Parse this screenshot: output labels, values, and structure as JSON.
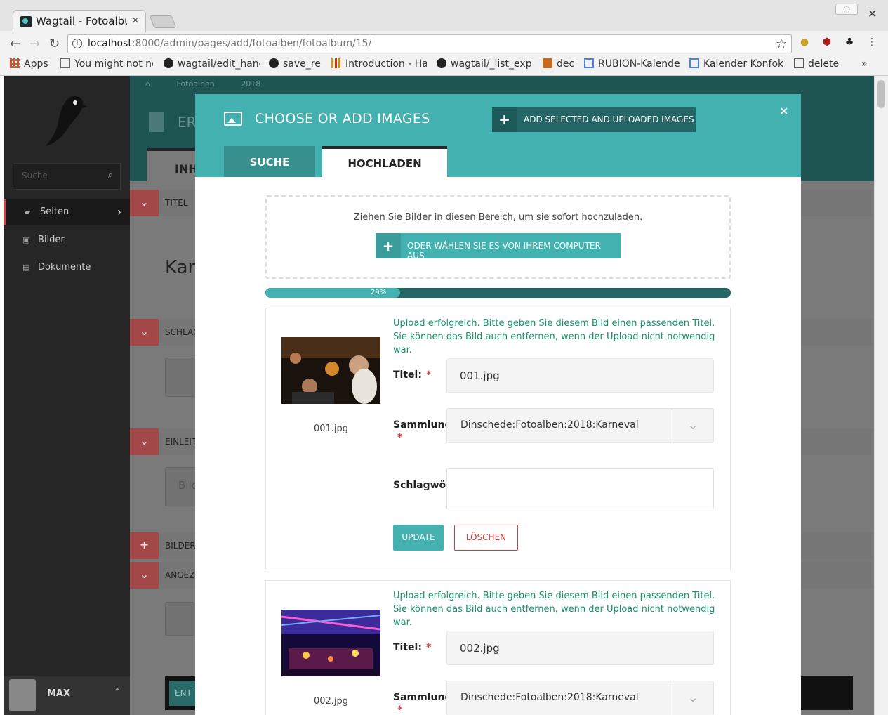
{
  "browser": {
    "tab_title": "Wagtail - Fotoalbum",
    "tab_close": "×",
    "url_host": "localhost",
    "url_path": ":8000/admin/pages/add/fotoalben/fotoalbum/15/",
    "bookmarks": [
      {
        "label": "Apps",
        "icon": "apps-grid-icon"
      },
      {
        "label": "You might not ne",
        "icon": "page-icon"
      },
      {
        "label": "wagtail/edit_hanc",
        "icon": "github-icon"
      },
      {
        "label": "save_re",
        "icon": "github-icon"
      },
      {
        "label": "Introduction - Ha",
        "icon": "chart-icon"
      },
      {
        "label": "wagtail/_list_exp",
        "icon": "github-icon"
      },
      {
        "label": "dec",
        "icon": "microscope-icon"
      },
      {
        "label": "RUBION-Kalende",
        "icon": "calendar-g-icon"
      },
      {
        "label": "Kalender Konfok",
        "icon": "calendar-g-icon"
      },
      {
        "label": "delete",
        "icon": "book-icon"
      }
    ],
    "bookmarks_more": "»"
  },
  "sidebar": {
    "search_placeholder": "Suche",
    "items": [
      {
        "label": "Seiten",
        "icon": "folder-open-icon"
      },
      {
        "label": "Bilder",
        "icon": "image-icon"
      },
      {
        "label": "Dokumente",
        "icon": "document-icon"
      }
    ],
    "user_name": "MAX"
  },
  "editor": {
    "breadcrumbs": [
      "Fotoalben",
      "2018"
    ],
    "title_partial": "ER",
    "tab_partial": "INH",
    "rows": [
      {
        "label": "TITEL",
        "button": "⌄"
      },
      {
        "label": "SCHLAG",
        "button": "⌄"
      },
      {
        "label": "EINLEIT",
        "button": "⌄"
      },
      {
        "label": "BILDER",
        "button": "+"
      },
      {
        "label": "ANGEZE",
        "button": "⌄"
      }
    ],
    "big_text": "Kar",
    "field_partial": "Bild",
    "bottom_button": "ENT"
  },
  "modal": {
    "title": "CHOOSE OR ADD IMAGES",
    "add_selected_label": "ADD SELECTED AND UPLOADED IMAGES",
    "close": "×",
    "tabs": [
      "SUCHE",
      "HOCHLADEN"
    ],
    "dropzone_text": "Ziehen Sie Bilder in diesen Bereich, um sie sofort hochzuladen.",
    "choose_button": "ODER WÄHLEN SIE ES VON IHREM COMPUTER AUS",
    "progress_percent": 29,
    "progress_label": "29%",
    "uploads": [
      {
        "message": "Upload erfolgreich. Bitte geben Sie diesem Bild einen passenden Titel. Sie können das Bild auch entfernen, wenn der Upload nicht notwendig war.",
        "filename": "001.jpg",
        "title_label": "Titel:",
        "title_value": "001.jpg",
        "collection_label": "Sammlung:",
        "collection_value": "Dinschede:Fotoalben:2018:Karneval",
        "tags_label": "Schlagwörter:",
        "tags_value": "",
        "update_label": "UPDATE",
        "delete_label": "LÖSCHEN"
      },
      {
        "message": "Upload erfolgreich. Bitte geben Sie diesem Bild einen passenden Titel. Sie können das Bild auch entfernen, wenn der Upload nicht notwendig war.",
        "filename": "002.jpg",
        "title_label": "Titel:",
        "title_value": "002.jpg",
        "collection_label": "Sammlung:",
        "collection_value": "Dinschede:Fotoalben:2018:Karneval"
      }
    ]
  },
  "colors": {
    "teal": "#43b1b0",
    "dark_teal": "#246666",
    "success_green": "#189370",
    "danger_red": "#cd3c3c",
    "sidebar_bg": "#262626"
  }
}
